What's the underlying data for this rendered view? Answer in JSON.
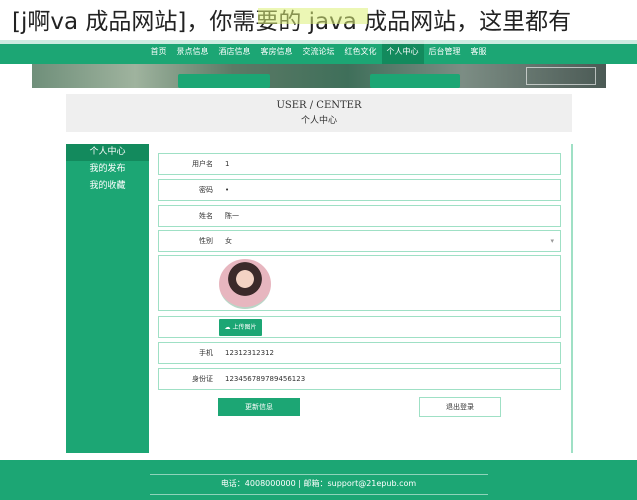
{
  "overlay": {
    "title": "[j啊va 成品网站]，你需要的 java 成品网站，这里都有"
  },
  "nav": {
    "items": [
      "首页",
      "景点信息",
      "酒店信息",
      "客房信息",
      "交流论坛",
      "红色文化",
      "个人中心",
      "后台管理",
      "客服"
    ],
    "active_index": 6
  },
  "header": {
    "title_en": "USER / CENTER",
    "title_cn": "个人中心"
  },
  "sidebar": {
    "items": [
      "个人中心",
      "我的发布",
      "我的收藏"
    ],
    "active_index": 0
  },
  "form": {
    "username": {
      "label": "用户名",
      "value": "1"
    },
    "password": {
      "label": "密码",
      "value": "•"
    },
    "name": {
      "label": "姓名",
      "value": "陈一"
    },
    "gender": {
      "label": "性别",
      "value": "女"
    },
    "upload_label": "上传图片",
    "phone": {
      "label": "手机",
      "value": "12312312312"
    },
    "id_card": {
      "label": "身份证",
      "value": "123456789789456123"
    }
  },
  "buttons": {
    "update": "更新信息",
    "logout": "退出登录"
  },
  "footer": {
    "text": "电话：4008000000 | 邮箱：support@21epub.com"
  },
  "colors": {
    "primary": "#1ca674",
    "primary_dark": "#138a5d",
    "border": "#9fe0c5",
    "header_bg": "#efefef"
  },
  "icons": {
    "select": "chevron-down-icon",
    "upload": "cloud-upload-icon"
  }
}
